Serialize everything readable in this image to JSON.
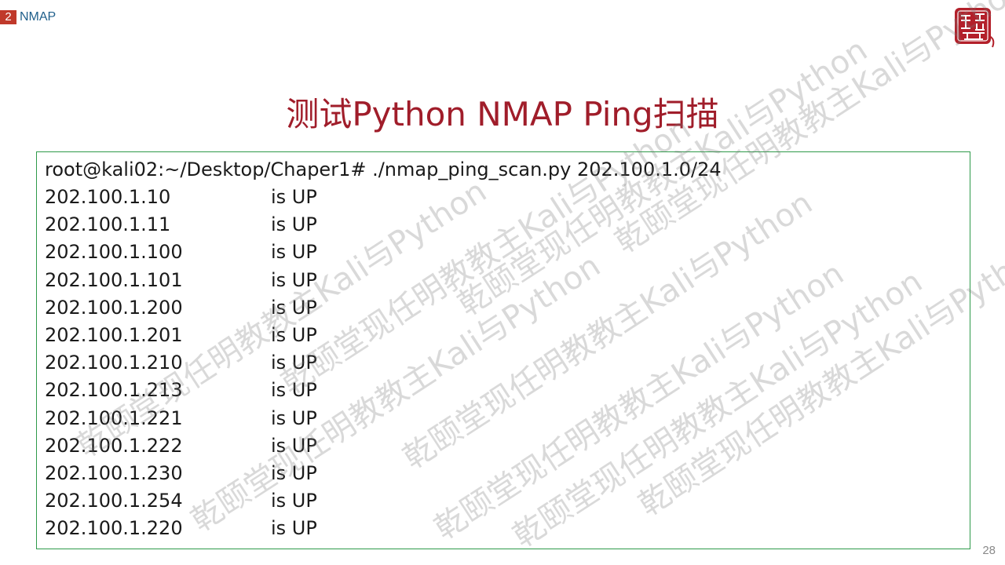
{
  "header": {
    "section_number": "2",
    "section_name": "NMAP"
  },
  "title": "测试Python NMAP Ping扫描",
  "terminal": {
    "command": "root@kali02:~/Desktop/Chaper1#  ./nmap_ping_scan.py  202.100.1.0/24",
    "results": [
      {
        "ip": "202.100.1.10",
        "status": "is UP"
      },
      {
        "ip": "202.100.1.11",
        "status": "is UP"
      },
      {
        "ip": "202.100.1.100",
        "status": "is UP"
      },
      {
        "ip": "202.100.1.101",
        "status": "is UP"
      },
      {
        "ip": "202.100.1.200",
        "status": "is UP"
      },
      {
        "ip": "202.100.1.201",
        "status": "is UP"
      },
      {
        "ip": "202.100.1.210",
        "status": "is UP"
      },
      {
        "ip": "202.100.1.213",
        "status": "is UP"
      },
      {
        "ip": "202.100.1.221",
        "status": "is UP"
      },
      {
        "ip": "202.100.1.222",
        "status": "is UP"
      },
      {
        "ip": "202.100.1.230",
        "status": "is UP"
      },
      {
        "ip": "202.100.1.254",
        "status": "is UP"
      },
      {
        "ip": "202.100.1.220",
        "status": "is UP"
      }
    ]
  },
  "watermark_text": "乾颐堂现任明教教主Kali与Python",
  "seal_text": "乾颐堂",
  "page_number": "28",
  "colors": {
    "title": "#a01d2a",
    "section_badge": "#c0392b",
    "section_name": "#1f5f8b",
    "terminal_border": "#2e9a4a",
    "seal": "#b3202a"
  }
}
